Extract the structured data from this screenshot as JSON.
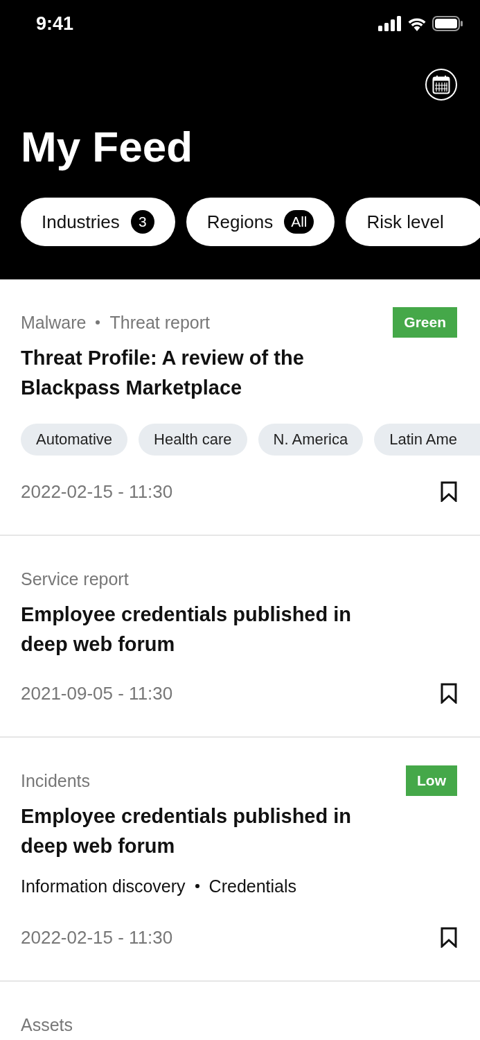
{
  "status_bar": {
    "time": "9:41"
  },
  "header": {
    "title": "My Feed"
  },
  "filters": [
    {
      "label": "Industries",
      "count": "3"
    },
    {
      "label": "Regions",
      "count": "All"
    },
    {
      "label": "Risk level"
    }
  ],
  "feed": [
    {
      "meta": [
        "Malware",
        "Threat report"
      ],
      "badge": {
        "label": "Green",
        "color": "#45a849"
      },
      "title": "Threat Profile: A review of the Blackpass Marketplace",
      "tags": [
        "Automative",
        "Health care",
        "N. America",
        "Latin Ame"
      ],
      "date": "2022-02-15 - 11:30",
      "bookmarked": false
    },
    {
      "meta": [
        "Service report"
      ],
      "title": "Employee credentials published in deep web forum",
      "date": "2021-09-05 - 11:30",
      "bookmarked": false
    },
    {
      "meta": [
        "Incidents"
      ],
      "badge": {
        "label": "Low",
        "color": "#45a849"
      },
      "title": "Employee credentials published in deep web forum",
      "topics": [
        "Information discovery",
        "Credentials"
      ],
      "date": "2022-02-15 - 11:30",
      "bookmarked": false
    },
    {
      "meta": [
        "Assets"
      ]
    }
  ]
}
